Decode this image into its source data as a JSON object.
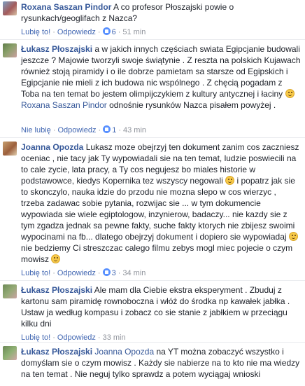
{
  "ui": {
    "like": "Lubię to!",
    "unlike": "Nie lubię",
    "reply": "Odpowiedz",
    "separator": "·"
  },
  "comments": [
    {
      "author": "Roxana Saszan Pindor",
      "text": "A co profesor Płoszajski powie o rysunkach/geoglifach z Nazca?",
      "likes": "6",
      "time": "51 min",
      "liked": false
    },
    {
      "author": "Łukasz Płoszajski",
      "text1": "a w jakich innych częściach swiata Egipcjanie budowali jeszcze ? Majowie tworzyli swoje świątynie . Z reszta na polskich Kujawach również stoją piramidy i o ile dobrze pamietam sa starsze od Egipskich i Egipcjanie nie mieli z ich budowa nic wspólnego . Z chęcią pogadam z Toba na ten temat bo jestem olimpijczykiem z kultury antycznej i łaciny",
      "mention": "Roxana Saszan Pindor",
      "text2": "odnośnie rysunków Nazca pisałem powyżej .",
      "likes": "1",
      "time": "43 min",
      "liked": true
    },
    {
      "author": "Joanna Opozda",
      "text1": "Lukasz moze obejrzyj ten dokument zanim cos zaczniesz oceniac , nie tacy jak Ty wypowiadali sie na ten temat, ludzie poswiecili na to cale zycie, lata pracy, a Ty cos negujesz bo miales historie w podstawowce, kiedys Kopernika tez wszyscy negowali",
      "text2": "i popatrz jak sie to skonczylo, nauka idzie do przodu nie mozna slepo w cos wierzyc , trzeba zadawac sobie pytania, rozwijac sie ... w tym dokumencie wypowiada sie wiele egiptologow, inzynierow, badaczy... nie kazdy sie z tym zgadza jednak sa pewne fakty, suche fakty ktorych nie zbijesz swoimi wypocinami na fb... dlatego obejrzyj dokument i dopiero sie wypowiadaj",
      "text3": "nie bedziemy Ci streszczac calego filmu zebys mogl miec pojecie o czym mowisz",
      "likes": "3",
      "time": "34 min",
      "liked": false
    },
    {
      "author": "Łukasz Płoszajski",
      "text": "Ale mam dla Ciebie ekstra eksperyment . Zbuduj z kartonu sam piramidę rownoboczna i włóż do środka np kawałek jabłka . Ustaw ja według kompasu i zobacz co sie stanie z jabłkiem w przeciągu kilku dni",
      "time": "33 min",
      "liked": false
    },
    {
      "author": "Łukasz Płoszajski",
      "mention": "Joanna Opozda",
      "text": "na YT można zobaczyć wszystko i domyślam sie o czym mowisz . Każdy sie nabierze na to kto nie ma wiedzy na ten temat . Nie neguj tylko sprawdz a potem wyciągaj wnioski"
    }
  ]
}
